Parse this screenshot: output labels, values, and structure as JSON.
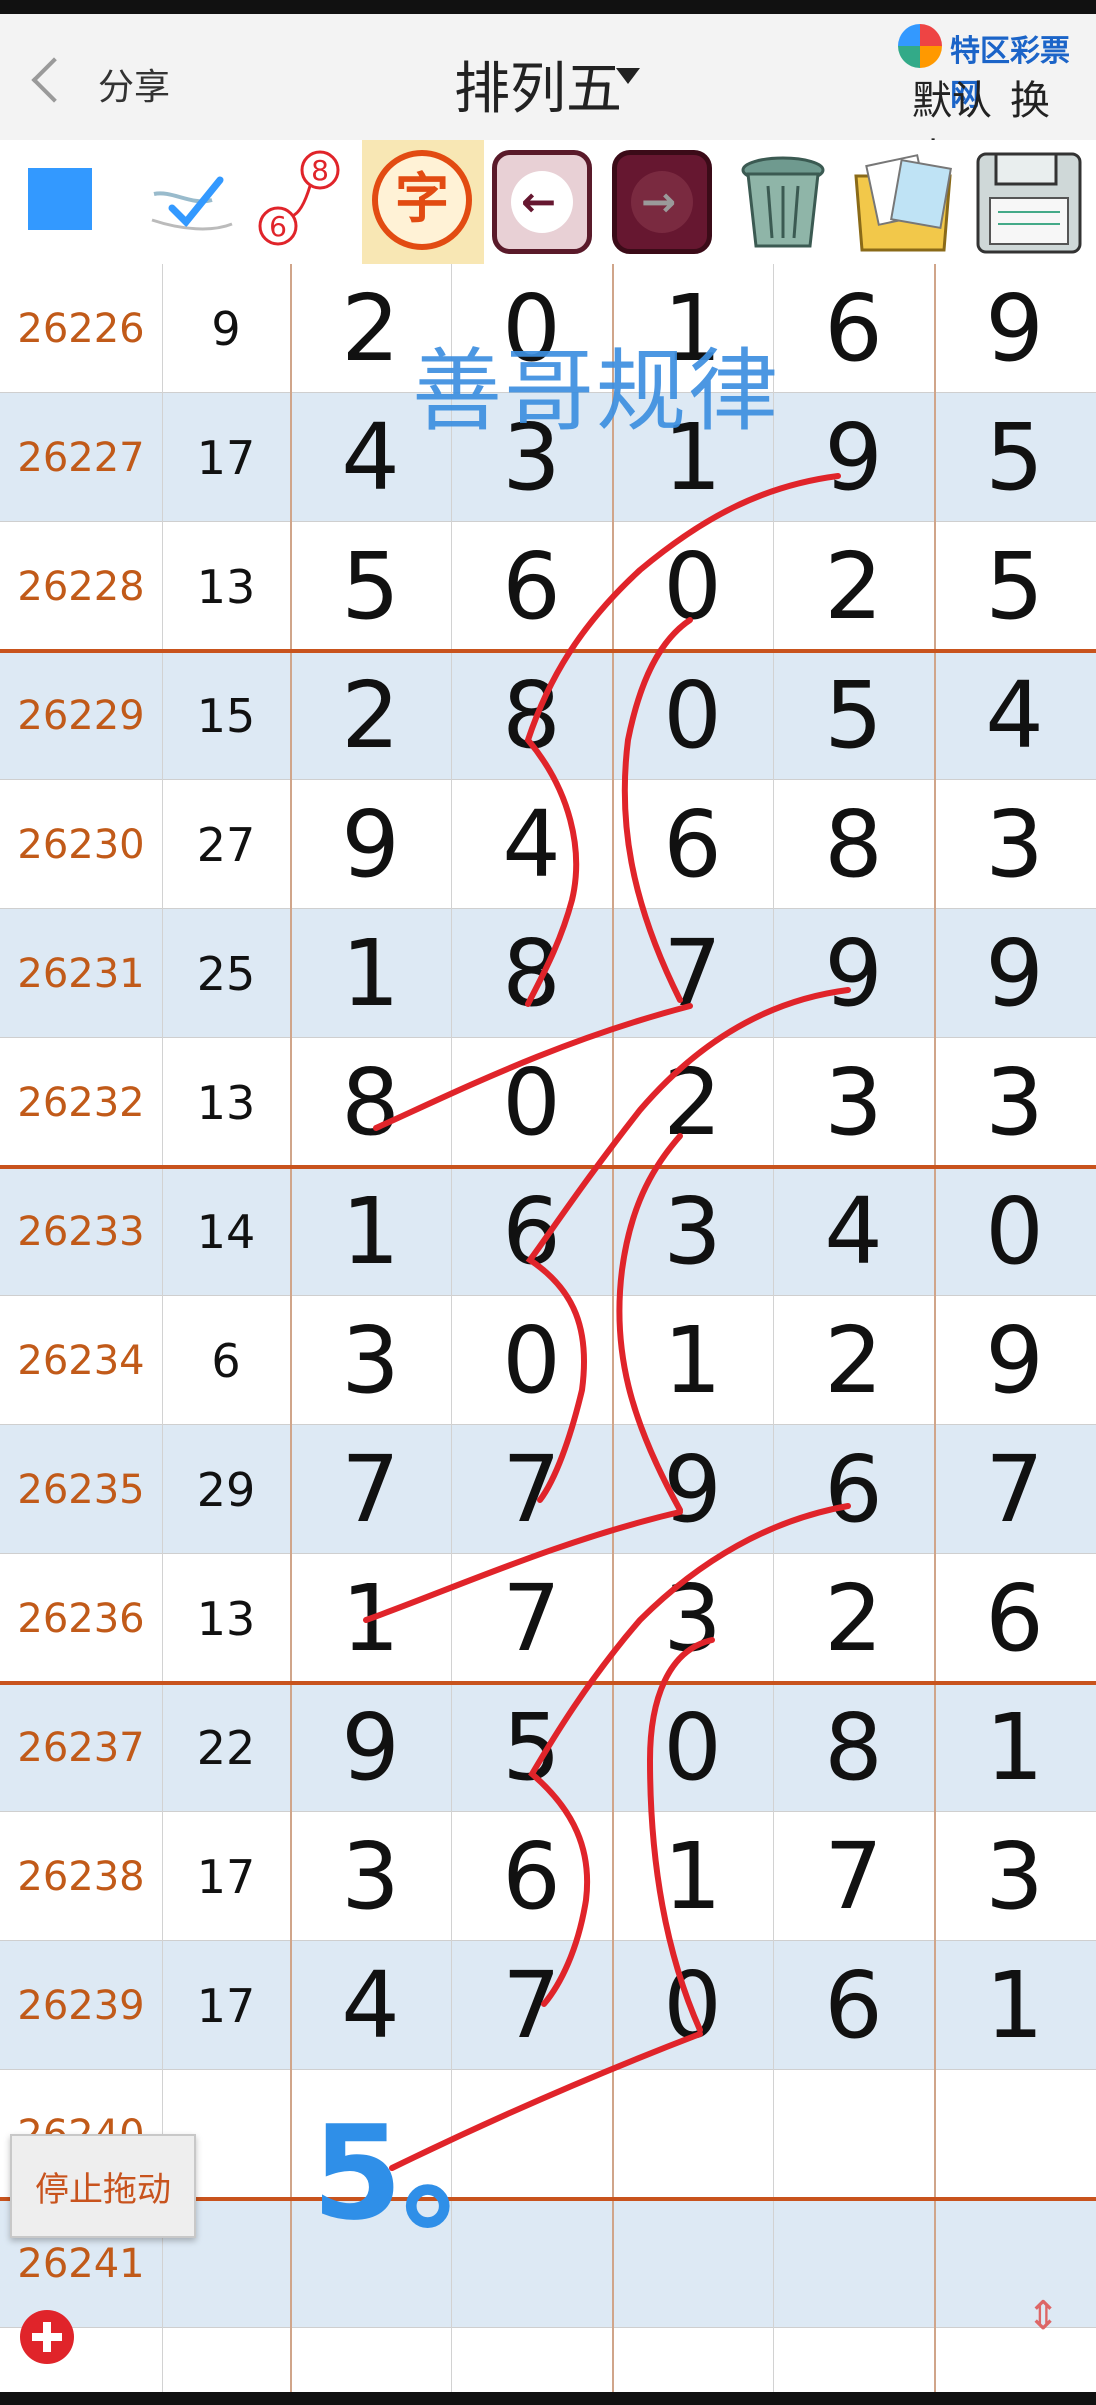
{
  "header": {
    "back_label": "分享",
    "title": "排列五",
    "right_actions": [
      "默认",
      "换皮"
    ],
    "logo_text": "特区彩票网"
  },
  "toolbar": {
    "tools": [
      "color-square",
      "pen",
      "number-connect",
      "字",
      "undo",
      "redo",
      "trash",
      "photo",
      "save"
    ],
    "num_marks": [
      "8",
      "6"
    ],
    "zi_label": "字",
    "accent_color": "#3399ff"
  },
  "overlay": {
    "watermark": "善哥规律",
    "handwritten_prediction": "5。",
    "stroke_color": "#e0242a",
    "pred_color": "#2f8fe8"
  },
  "rows": [
    {
      "issue": "26226",
      "sum": "9",
      "digits": [
        "2",
        "0",
        "1",
        "6",
        "9"
      ]
    },
    {
      "issue": "26227",
      "sum": "17",
      "digits": [
        "4",
        "3",
        "1",
        "9",
        "5"
      ]
    },
    {
      "issue": "26228",
      "sum": "13",
      "digits": [
        "5",
        "6",
        "0",
        "2",
        "5"
      ]
    },
    {
      "issue": "26229",
      "sum": "15",
      "digits": [
        "2",
        "8",
        "0",
        "5",
        "4"
      ]
    },
    {
      "issue": "26230",
      "sum": "27",
      "digits": [
        "9",
        "4",
        "6",
        "8",
        "3"
      ]
    },
    {
      "issue": "26231",
      "sum": "25",
      "digits": [
        "1",
        "8",
        "7",
        "9",
        "9"
      ]
    },
    {
      "issue": "26232",
      "sum": "13",
      "digits": [
        "8",
        "0",
        "2",
        "3",
        "3"
      ]
    },
    {
      "issue": "26233",
      "sum": "14",
      "digits": [
        "1",
        "6",
        "3",
        "4",
        "0"
      ]
    },
    {
      "issue": "26234",
      "sum": "6",
      "digits": [
        "3",
        "0",
        "1",
        "2",
        "9"
      ]
    },
    {
      "issue": "26235",
      "sum": "29",
      "digits": [
        "7",
        "7",
        "9",
        "6",
        "7"
      ]
    },
    {
      "issue": "26236",
      "sum": "13",
      "digits": [
        "1",
        "7",
        "3",
        "2",
        "6"
      ]
    },
    {
      "issue": "26237",
      "sum": "22",
      "digits": [
        "9",
        "5",
        "0",
        "8",
        "1"
      ]
    },
    {
      "issue": "26238",
      "sum": "17",
      "digits": [
        "3",
        "6",
        "1",
        "7",
        "3"
      ]
    },
    {
      "issue": "26239",
      "sum": "17",
      "digits": [
        "4",
        "7",
        "0",
        "6",
        "1"
      ]
    },
    {
      "issue": "26240",
      "sum": "",
      "digits": [
        "",
        "",
        "",
        "",
        ""
      ]
    },
    {
      "issue": "26241",
      "sum": "",
      "digits": [
        "",
        "",
        "",
        "",
        ""
      ]
    }
  ],
  "controls": {
    "stop_drag_label": "停止拖动",
    "scroll_indicator": "⇕"
  }
}
